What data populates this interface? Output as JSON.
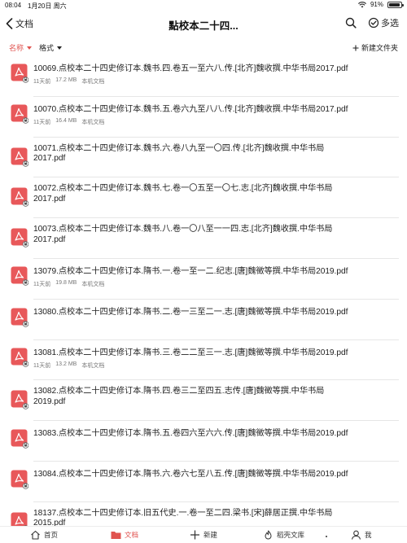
{
  "status": {
    "time": "08:04",
    "date": "1月20日 周六",
    "battery": "91%",
    "battery_level": 0.91
  },
  "nav": {
    "back_label": "文档",
    "title": "點校本二十四...",
    "multi_select": "多选"
  },
  "toolbar": {
    "sort_label": "名称",
    "format_label": "格式",
    "new_folder": "新建文件夹"
  },
  "files": [
    {
      "line1": "10069.点校本二十四史修订本.魏书.四.卷五一至六八.传.[北齐]魏收撰.中华书局2017.pdf",
      "line2": "",
      "age": "11天前",
      "size": "17.2 MB",
      "location": "本机文档"
    },
    {
      "line1": "10070.点校本二十四史修订本.魏书.五.卷六九至八八.传.[北齐]魏收撰.中华书局2017.pdf",
      "line2": "",
      "age": "11天前",
      "size": "16.4 MB",
      "location": "本机文档"
    },
    {
      "line1": "10071.点校本二十四史修订本.魏书.六.卷八九至一〇四.传.[北齐]魏收撰.中华书局",
      "line2": "2017.pdf",
      "age": "",
      "size": "",
      "location": ""
    },
    {
      "line1": "10072.点校本二十四史修订本.魏书.七.卷一〇五至一〇七.志.[北齐]魏收撰.中华书局",
      "line2": "2017.pdf",
      "age": "",
      "size": "",
      "location": ""
    },
    {
      "line1": "10073.点校本二十四史修订本.魏书.八.卷一〇八至一一四.志.[北齐]魏收撰.中华书局",
      "line2": "2017.pdf",
      "age": "",
      "size": "",
      "location": ""
    },
    {
      "line1": "13079.点校本二十四史修订本.隋书.一.卷一至一二.纪志.[唐]魏徵等撰.中华书局2019.pdf",
      "line2": "",
      "age": "11天前",
      "size": "19.8 MB",
      "location": "本机文档"
    },
    {
      "line1": "13080.点校本二十四史修订本.隋书.二.卷一三至二一.志.[唐]魏徵等撰.中华书局2019.pdf",
      "line2": "",
      "age": "",
      "size": "",
      "location": ""
    },
    {
      "line1": "13081.点校本二十四史修订本.隋书.三.卷二二至三一.志.[唐]魏徵等撰.中华书局2019.pdf",
      "line2": "",
      "age": "11天前",
      "size": "13.2 MB",
      "location": "本机文档"
    },
    {
      "line1": "13082.点校本二十四史修订本.隋书.四.卷三二至四五.志传.[唐]魏徵等撰.中华书局",
      "line2": "2019.pdf",
      "age": "",
      "size": "",
      "location": ""
    },
    {
      "line1": "13083.点校本二十四史修订本.隋书.五.卷四六至六六.传.[唐]魏徵等撰.中华书局2019.pdf",
      "line2": "",
      "age": "",
      "size": "",
      "location": ""
    },
    {
      "line1": "13084.点校本二十四史修订本.隋书.六.卷六七至八五.传.[唐]魏徵等撰.中华书局2019.pdf",
      "line2": "",
      "age": "",
      "size": "",
      "location": ""
    },
    {
      "line1": "18137.点校本二十四史修订本.旧五代史.一.卷一至二四.梁书.[宋]薛居正撰.中华书局",
      "line2": "2015.pdf",
      "age": "",
      "size": "",
      "location": ""
    }
  ],
  "tabs": [
    {
      "label": "首页",
      "icon": "home-icon"
    },
    {
      "label": "文档",
      "icon": "folder-icon"
    },
    {
      "label": "新建",
      "icon": "plus-icon"
    },
    {
      "label": "稻壳文库",
      "icon": "flame-icon"
    },
    {
      "label": "我",
      "icon": "person-icon"
    }
  ],
  "colors": {
    "accent": "#e0534f",
    "pdf_icon": "#e8585a"
  }
}
